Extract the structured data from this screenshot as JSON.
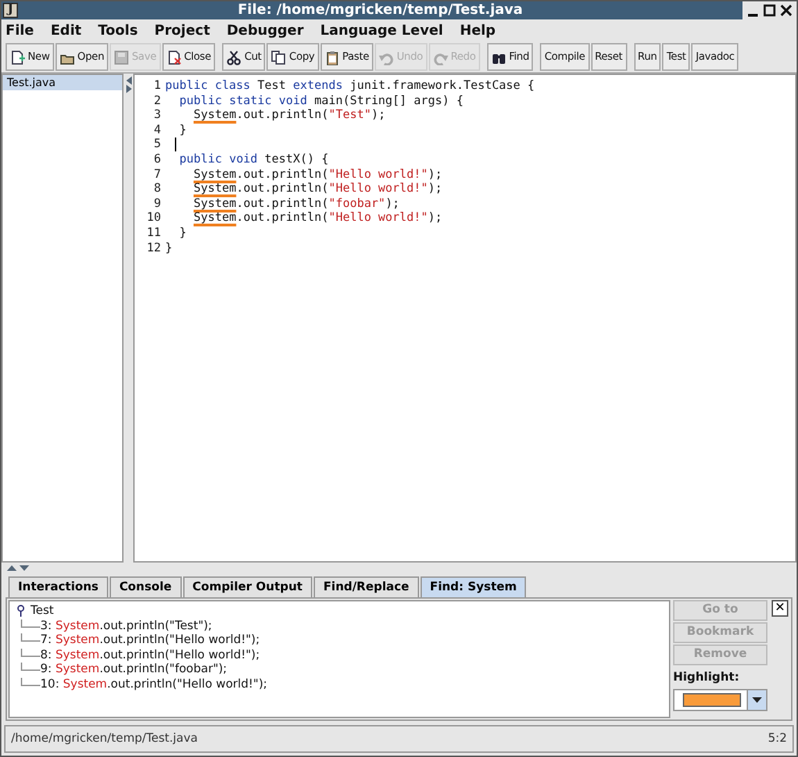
{
  "window": {
    "title": "File: /home/mgricken/temp/Test.java",
    "app_icon": "J"
  },
  "menu": [
    "File",
    "Edit",
    "Tools",
    "Project",
    "Debugger",
    "Language Level",
    "Help"
  ],
  "toolbar": [
    [
      {
        "label": "New",
        "disabled": false
      },
      {
        "label": "Open",
        "disabled": false
      },
      {
        "label": "Save",
        "disabled": true
      },
      {
        "label": "Close",
        "disabled": false
      }
    ],
    [
      {
        "label": "Cut",
        "disabled": false
      },
      {
        "label": "Copy",
        "disabled": false
      },
      {
        "label": "Paste",
        "disabled": false
      },
      {
        "label": "Undo",
        "disabled": true
      },
      {
        "label": "Redo",
        "disabled": true
      }
    ],
    [
      {
        "label": "Find",
        "disabled": false
      }
    ],
    [
      {
        "label": "Compile",
        "disabled": false
      },
      {
        "label": "Reset",
        "disabled": false
      }
    ],
    [
      {
        "label": "Run",
        "disabled": false
      },
      {
        "label": "Test",
        "disabled": false
      },
      {
        "label": "Javadoc",
        "disabled": false
      }
    ]
  ],
  "files": [
    {
      "name": "Test.java",
      "selected": true
    }
  ],
  "editor": {
    "lines": [
      {
        "number": "1",
        "kind": "code",
        "tokens": [
          {
            "kind": "kw",
            "text": "public class"
          },
          {
            "kind": "plain",
            "text": " Test "
          },
          {
            "kind": "kw",
            "text": "extends"
          },
          {
            "kind": "plain",
            "text": " junit.framework.TestCase {"
          }
        ]
      },
      {
        "number": "2",
        "kind": "code",
        "tokens": [
          {
            "kind": "kw",
            "text": "  public static void"
          },
          {
            "kind": "plain",
            "text": " main(String[] args) {"
          }
        ]
      },
      {
        "number": "3",
        "kind": "code",
        "tokens": [
          {
            "kind": "match",
            "text": "    System"
          },
          {
            "kind": "plain",
            "text": ".out.println("
          },
          {
            "kind": "str",
            "text": "\"Test\""
          },
          {
            "kind": "plain",
            "text": ");"
          }
        ]
      },
      {
        "number": "4",
        "kind": "code",
        "tokens": [
          {
            "kind": "plain",
            "text": "  }"
          }
        ]
      },
      {
        "number": "5",
        "kind": "caret"
      },
      {
        "number": "6",
        "kind": "code",
        "tokens": [
          {
            "kind": "kw",
            "text": "  public void"
          },
          {
            "kind": "plain",
            "text": " testX() {"
          }
        ]
      },
      {
        "number": "7",
        "kind": "code",
        "tokens": [
          {
            "kind": "match",
            "text": "    System"
          },
          {
            "kind": "plain",
            "text": ".out.println("
          },
          {
            "kind": "str",
            "text": "\"Hello world!\""
          },
          {
            "kind": "plain",
            "text": ");"
          }
        ]
      },
      {
        "number": "8",
        "kind": "code",
        "tokens": [
          {
            "kind": "match",
            "text": "    System"
          },
          {
            "kind": "plain",
            "text": ".out.println("
          },
          {
            "kind": "str",
            "text": "\"Hello world!\""
          },
          {
            "kind": "plain",
            "text": ");"
          }
        ]
      },
      {
        "number": "9",
        "kind": "code",
        "tokens": [
          {
            "kind": "match",
            "text": "    System"
          },
          {
            "kind": "plain",
            "text": ".out.println("
          },
          {
            "kind": "str",
            "text": "\"foobar\""
          },
          {
            "kind": "plain",
            "text": ");"
          }
        ]
      },
      {
        "number": "10",
        "kind": "code",
        "tokens": [
          {
            "kind": "match",
            "text": "    System"
          },
          {
            "kind": "plain",
            "text": ".out.println("
          },
          {
            "kind": "str",
            "text": "\"Hello world!\""
          },
          {
            "kind": "plain",
            "text": ");"
          }
        ]
      },
      {
        "number": "11",
        "kind": "code",
        "tokens": [
          {
            "kind": "plain",
            "text": "  }"
          }
        ]
      },
      {
        "number": "12",
        "kind": "code",
        "tokens": [
          {
            "kind": "plain",
            "text": "}"
          }
        ]
      }
    ]
  },
  "tabs": [
    {
      "label": "Interactions",
      "selected": false
    },
    {
      "label": "Console",
      "selected": false
    },
    {
      "label": "Compiler Output",
      "selected": false
    },
    {
      "label": "Find/Replace",
      "selected": false
    },
    {
      "label": "Find: System",
      "selected": true
    }
  ],
  "results": {
    "root": "Test",
    "expanded": true,
    "children": [
      {
        "line": "3:",
        "match": "System",
        "rest": ".out.println(\"Test\");"
      },
      {
        "line": "7:",
        "match": "System",
        "rest": ".out.println(\"Hello world!\");"
      },
      {
        "line": "8:",
        "match": "System",
        "rest": ".out.println(\"Hello world!\");"
      },
      {
        "line": "9:",
        "match": "System",
        "rest": ".out.println(\"foobar\");"
      },
      {
        "line": "10:",
        "match": "System",
        "rest": ".out.println(\"Hello world!\");"
      }
    ]
  },
  "actions": [
    {
      "label": "Go to",
      "disabled": true
    },
    {
      "label": "Bookmark",
      "disabled": true
    },
    {
      "label": "Remove",
      "disabled": true
    }
  ],
  "highlight": {
    "label": "Highlight:",
    "color": "#f99b3a"
  },
  "close_symbol": "✕",
  "status_bar": {
    "path": "/home/mgricken/temp/Test.java",
    "position": "5:2"
  }
}
